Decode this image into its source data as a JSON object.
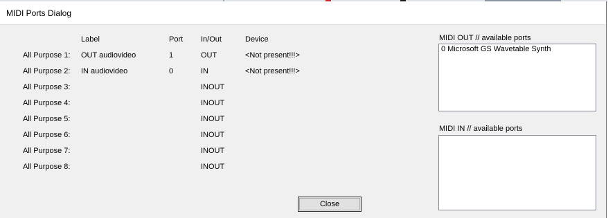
{
  "dialog": {
    "title": "MIDI Ports Dialog",
    "headers": {
      "label": "Label",
      "port": "Port",
      "inout": "In/Out",
      "device": "Device"
    },
    "rows": [
      {
        "name": "All Purpose 1:",
        "label": "OUT audiovideo",
        "port": "1",
        "inout": "OUT",
        "device": "<Not present!!!>"
      },
      {
        "name": "All Purpose 2:",
        "label": "IN audiovideo",
        "port": "0",
        "inout": "IN",
        "device": "<Not present!!!>"
      },
      {
        "name": "All Purpose 3:",
        "label": "",
        "port": "",
        "inout": "INOUT",
        "device": ""
      },
      {
        "name": "All Purpose 4:",
        "label": "",
        "port": "",
        "inout": "INOUT",
        "device": ""
      },
      {
        "name": "All Purpose 5:",
        "label": "",
        "port": "",
        "inout": "INOUT",
        "device": ""
      },
      {
        "name": "All Purpose 6:",
        "label": "",
        "port": "",
        "inout": "INOUT",
        "device": ""
      },
      {
        "name": "All Purpose 7:",
        "label": "",
        "port": "",
        "inout": "INOUT",
        "device": ""
      },
      {
        "name": "All Purpose 8:",
        "label": "",
        "port": "",
        "inout": "INOUT",
        "device": ""
      }
    ],
    "midi_out": {
      "heading": "MIDI OUT // available ports",
      "items": [
        "0 Microsoft GS Wavetable Synth"
      ]
    },
    "midi_in": {
      "heading": "MIDI IN // available ports",
      "items": []
    },
    "close_label": "Close"
  }
}
